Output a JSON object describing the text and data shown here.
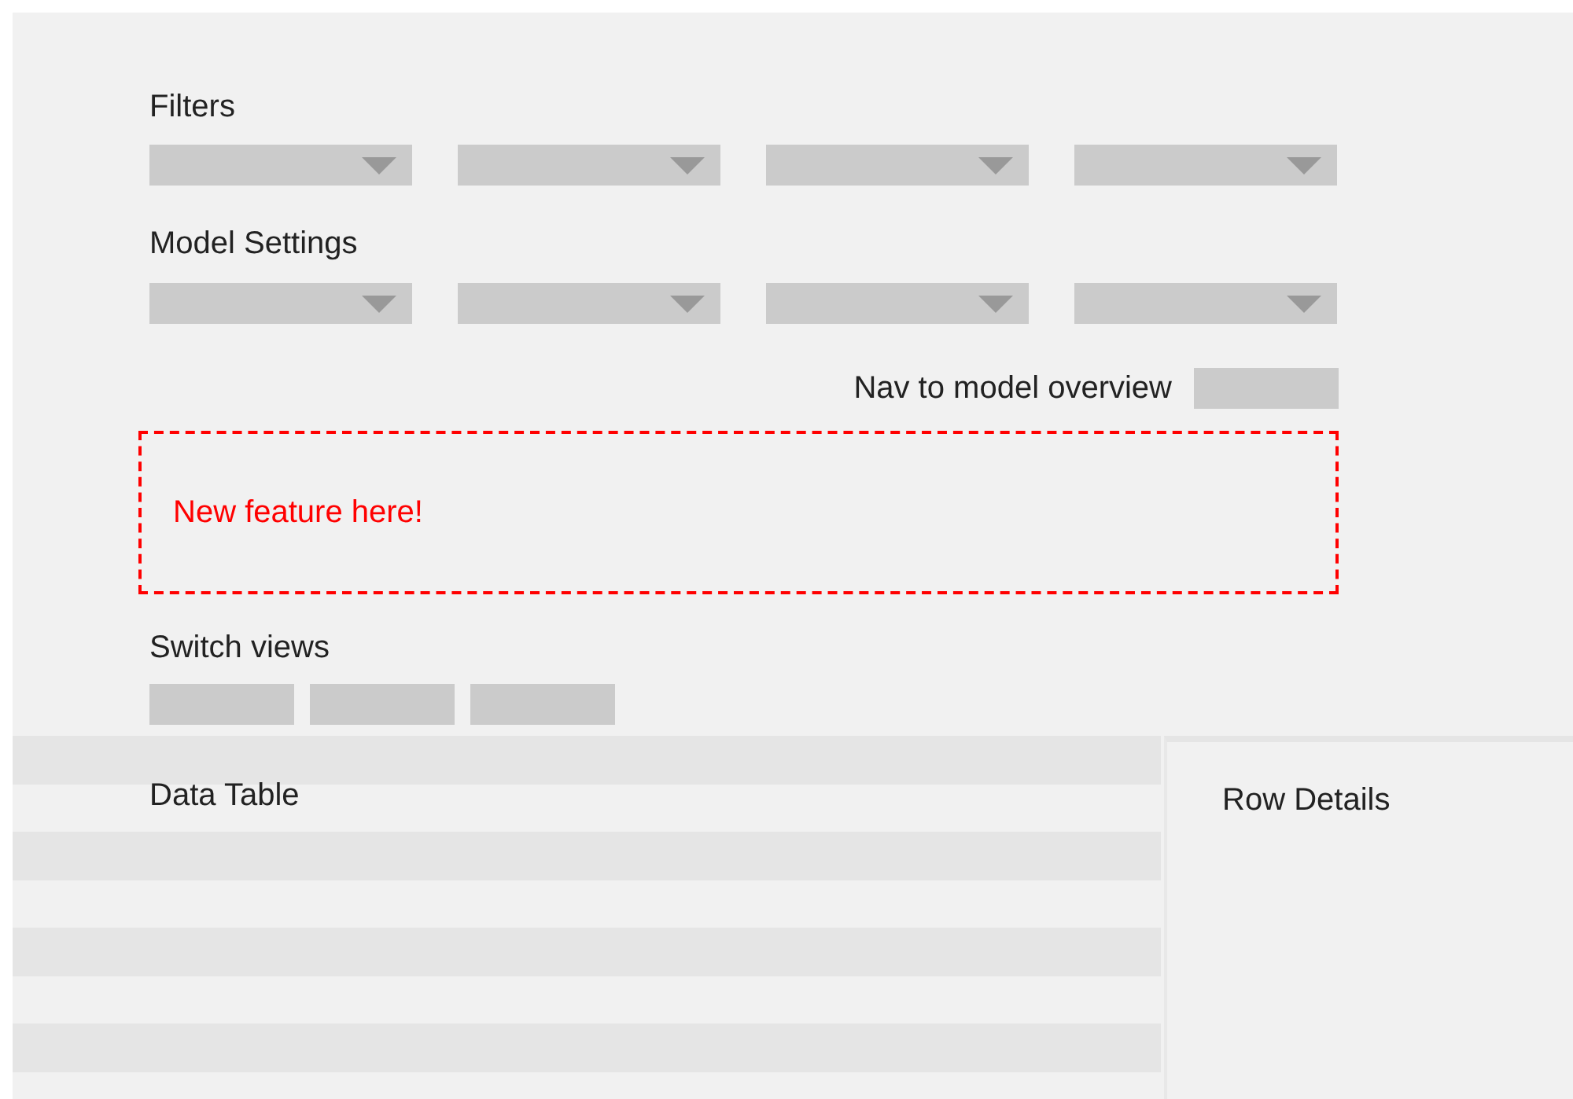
{
  "filters": {
    "label": "Filters",
    "dropdowns": [
      {
        "kind": "dropdown"
      },
      {
        "kind": "dropdown"
      },
      {
        "kind": "dropdown"
      },
      {
        "kind": "dropdown"
      }
    ]
  },
  "model_settings": {
    "label": "Model Settings",
    "dropdowns": [
      {
        "kind": "dropdown"
      },
      {
        "kind": "dropdown"
      },
      {
        "kind": "dropdown"
      },
      {
        "kind": "dropdown"
      }
    ]
  },
  "nav": {
    "label": "Nav to model overview"
  },
  "feature_placeholder": {
    "text": "New feature here!"
  },
  "switch_views": {
    "label": "Switch views",
    "buttons": [
      {
        "kind": "button"
      },
      {
        "kind": "button"
      },
      {
        "kind": "button"
      }
    ]
  },
  "data_table": {
    "title": "Data Table",
    "rows": [
      {
        "kind": "shaded"
      },
      {
        "kind": "plain"
      },
      {
        "kind": "shaded"
      },
      {
        "kind": "plain"
      },
      {
        "kind": "shaded"
      },
      {
        "kind": "plain"
      },
      {
        "kind": "shaded"
      },
      {
        "kind": "plain"
      }
    ]
  },
  "row_details": {
    "title": "Row Details"
  }
}
